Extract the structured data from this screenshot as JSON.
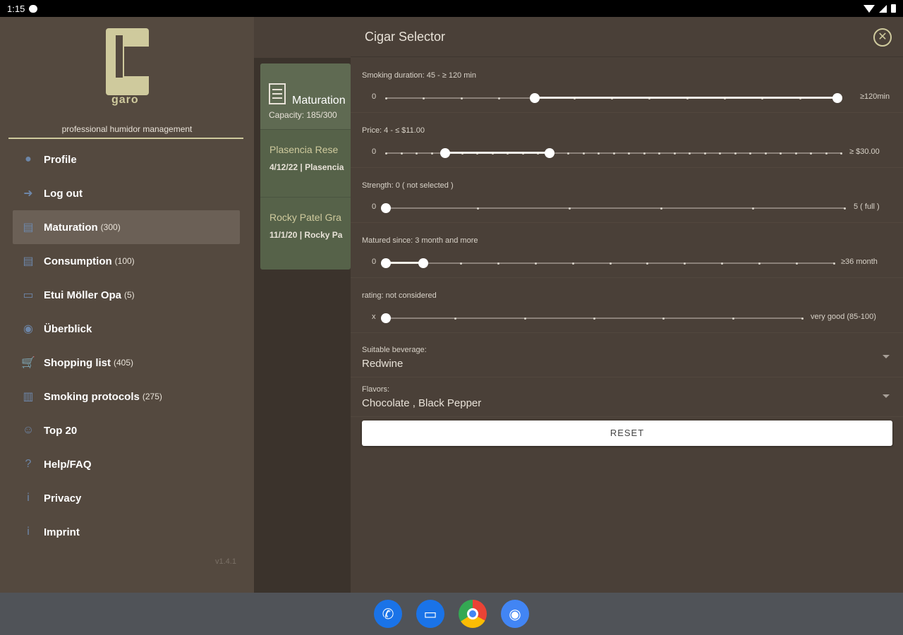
{
  "status": {
    "time": "1:15"
  },
  "drawer": {
    "logo_text": "garo",
    "tagline": "professional humidor management",
    "version": "v1.4.1",
    "items": [
      {
        "label": "Profile",
        "count": "",
        "icon": "person-icon"
      },
      {
        "label": "Log out",
        "count": "",
        "icon": "logout-icon"
      },
      {
        "label": "Maturation",
        "count": "(300)",
        "icon": "humidor-icon",
        "active": true
      },
      {
        "label": "Consumption",
        "count": "(100)",
        "icon": "humidor-icon"
      },
      {
        "label": "Etui Möller Opa",
        "count": "(5)",
        "icon": "case-icon"
      },
      {
        "label": "Überblick",
        "count": "",
        "icon": "eye-icon"
      },
      {
        "label": "Shopping list",
        "count": "(405)",
        "icon": "cart-icon"
      },
      {
        "label": "Smoking protocols",
        "count": "(275)",
        "icon": "notebook-icon"
      },
      {
        "label": "Top 20",
        "count": "",
        "icon": "rating-icon"
      },
      {
        "label": "Help/FAQ",
        "count": "",
        "icon": "help-icon"
      },
      {
        "label": "Privacy",
        "count": "",
        "icon": "info-icon"
      },
      {
        "label": "Imprint",
        "count": "",
        "icon": "info-icon"
      }
    ]
  },
  "list": {
    "header_title": "Maturation",
    "header_capacity": "Capacity: 185/300",
    "items": [
      {
        "title": "Plasencia Rese",
        "subtitle": "4/12/22 | Plasencia"
      },
      {
        "title": "Rocky Patel Gra",
        "subtitle": "11/1/20 | Rocky Pa"
      }
    ]
  },
  "panel": {
    "title": "Cigar Selector",
    "sliders": [
      {
        "caption": "Smoking duration: 45 - ≥ 120 min",
        "min_label": "0",
        "max_label": "≥120min",
        "range": [
          0.33,
          1.0
        ],
        "ticks": 12
      },
      {
        "caption": "Price: 4 - ≤ $11.00",
        "min_label": "0",
        "max_label": "≥ $30.00",
        "range": [
          0.13,
          0.36
        ],
        "ticks": 30
      },
      {
        "caption": "Strength: 0 ( not selected )",
        "min_label": "0",
        "max_label": "5 ( full )",
        "range": [
          0.0,
          0.0
        ],
        "ticks": 5
      },
      {
        "caption": "Matured since: 3 month and more",
        "min_label": "0",
        "max_label": "≥36 month",
        "range": [
          0.0,
          0.083
        ],
        "ticks": 12
      },
      {
        "caption": "rating: not considered",
        "min_label": "x",
        "max_label": "very good (85-100)",
        "range": [
          0.0,
          0.0
        ],
        "ticks": 6
      }
    ],
    "beverage": {
      "caption": "Suitable beverage:",
      "value": "Redwine"
    },
    "flavors": {
      "caption": "Flavors:",
      "value": "Chocolate , Black Pepper"
    },
    "reset_label": "RESET"
  }
}
